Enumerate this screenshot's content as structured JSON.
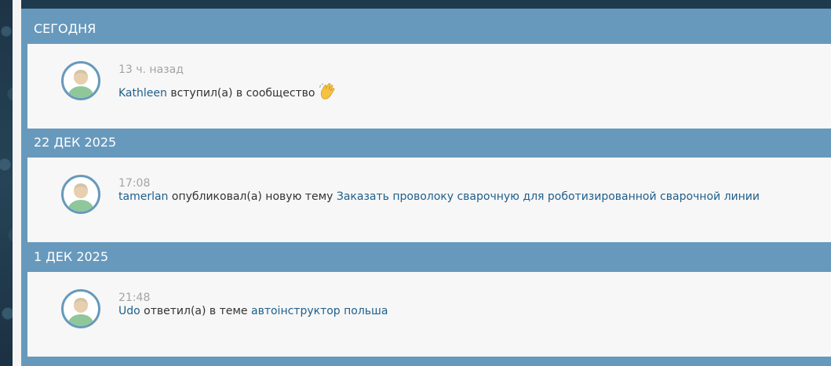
{
  "colors": {
    "header": "#6799bd",
    "body": "#f7f7f7",
    "link": "#1e5f8c",
    "time": "#a4a4a4"
  },
  "sections": [
    {
      "header": "СЕГОДНЯ",
      "entry": {
        "time": "13 ч. назад",
        "user": "Kathleen",
        "action": " вступил(а) в сообщество",
        "emoji_icon": "waving-hand-icon"
      }
    },
    {
      "header": "22 ДЕК 2025",
      "entry": {
        "time": "17:08",
        "user": "tamerlan",
        "action": " опубликовал(а) новую тему ",
        "target": "Заказать проволоку сварочную для роботизированной сварочной линии"
      }
    },
    {
      "header": "1 ДЕК 2025",
      "entry": {
        "time": "21:48",
        "user": "Udo",
        "action": " ответил(а) в теме ",
        "target": "автоінструктор польша"
      }
    }
  ]
}
